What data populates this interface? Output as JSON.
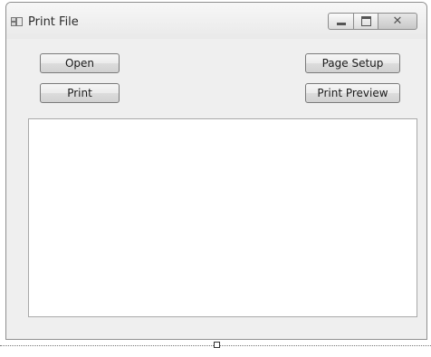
{
  "window": {
    "title": "Print File",
    "controls": {
      "minimize": "minimize-icon",
      "maximize": "maximize-icon",
      "close": "close-icon"
    }
  },
  "buttons": {
    "open": "Open",
    "print": "Print",
    "page_setup": "Page Setup",
    "print_preview": "Print Preview"
  },
  "text_area": {
    "value": ""
  },
  "colors": {
    "background": "#efefef",
    "button_border": "#7a7a7a",
    "textbox_background": "#ffffff"
  }
}
